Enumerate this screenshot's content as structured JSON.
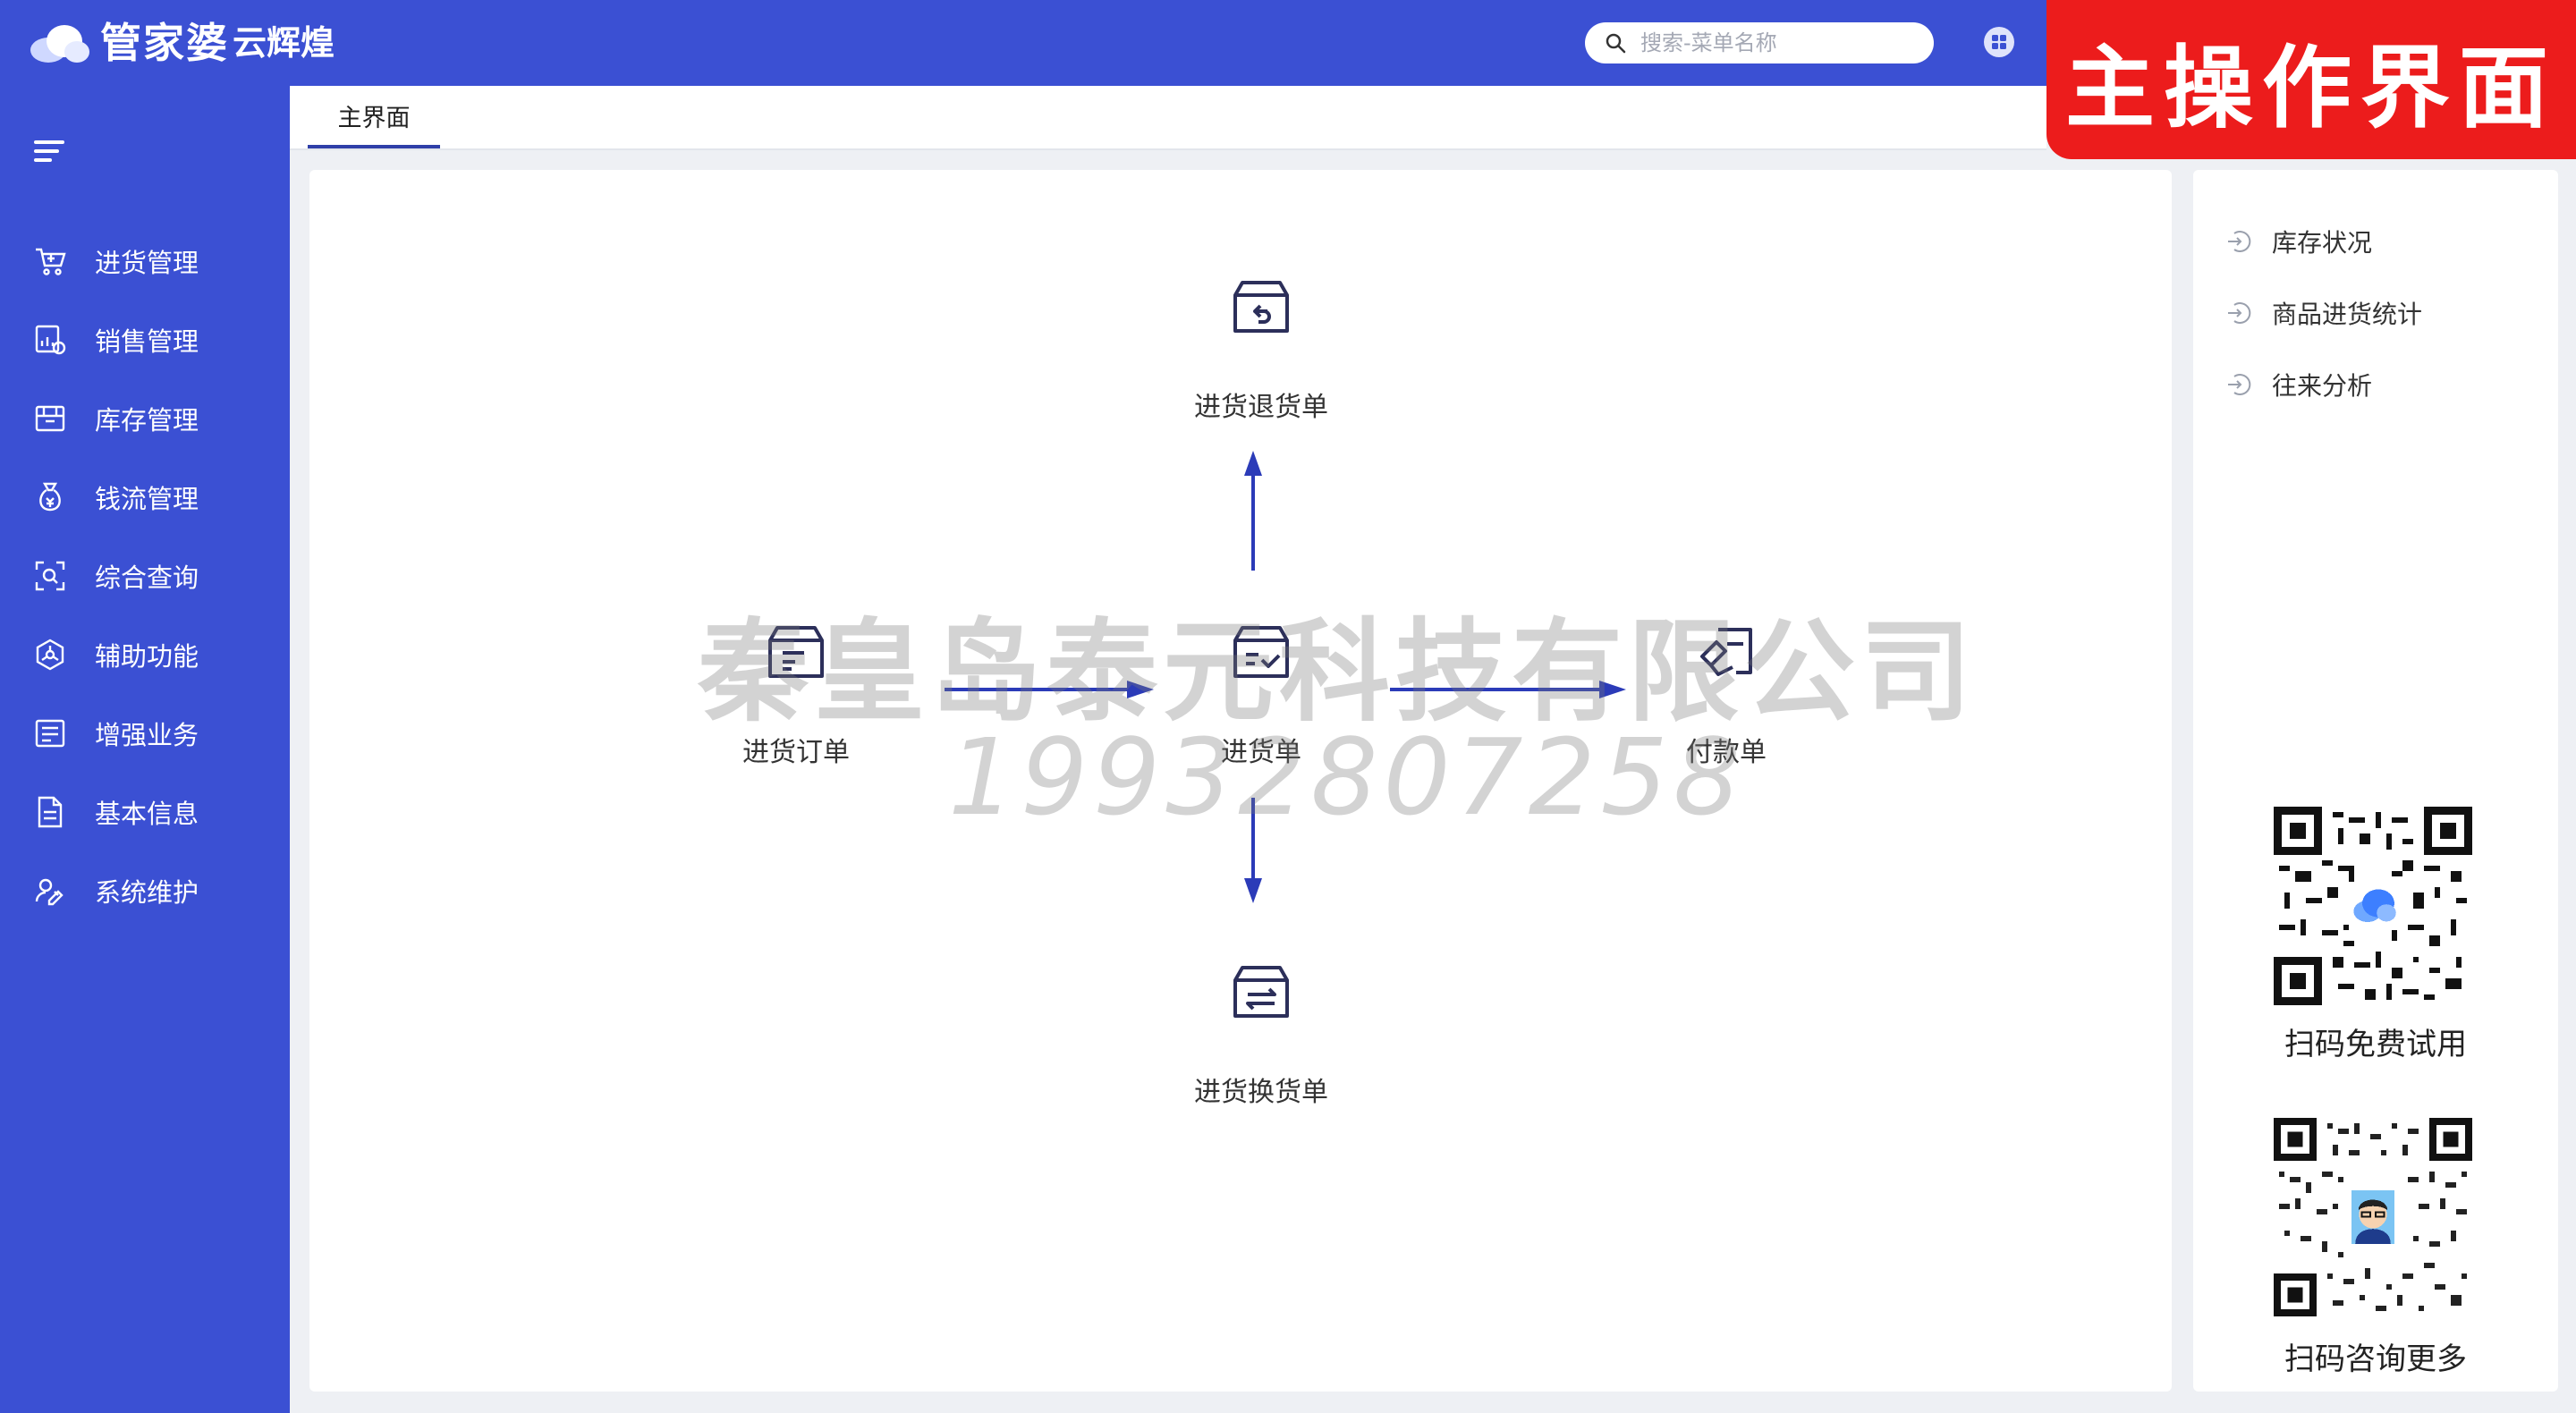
{
  "app": {
    "logo_text": "管家婆",
    "logo_sub": "云辉煌",
    "search_placeholder": "搜索-菜单名称",
    "banner": "主操作界面"
  },
  "sidebar": {
    "items": [
      {
        "label": "进货管理",
        "icon": "cart-icon"
      },
      {
        "label": "销售管理",
        "icon": "sales-chart-icon"
      },
      {
        "label": "库存管理",
        "icon": "inventory-box-icon"
      },
      {
        "label": "钱流管理",
        "icon": "money-bag-icon"
      },
      {
        "label": "综合查询",
        "icon": "query-scan-icon"
      },
      {
        "label": "辅助功能",
        "icon": "hexagon-assist-icon"
      },
      {
        "label": "增强业务",
        "icon": "enhanced-form-icon"
      },
      {
        "label": "基本信息",
        "icon": "document-icon"
      },
      {
        "label": "系统维护",
        "icon": "maintenance-icon"
      }
    ]
  },
  "tabs": [
    {
      "label": "主界面"
    }
  ],
  "flow": {
    "return_order": "进货退货单",
    "purchase_order": "进货订单",
    "purchase_receipt": "进货单",
    "payment": "付款单",
    "exchange_order": "进货换货单"
  },
  "watermark": {
    "company": "秦皇岛泰元科技有限公司",
    "phone": "19932807258"
  },
  "right_panel": {
    "links": [
      "库存状况",
      "商品进货统计",
      "往来分析"
    ],
    "qr_trial_label": "扫码免费试用",
    "qr_consult_label": "扫码咨询更多"
  },
  "colors": {
    "primary": "#3b50d3",
    "banner": "#ec1c1c",
    "arrow": "#2b3bb8",
    "icon_dark": "#2c2f5a"
  }
}
